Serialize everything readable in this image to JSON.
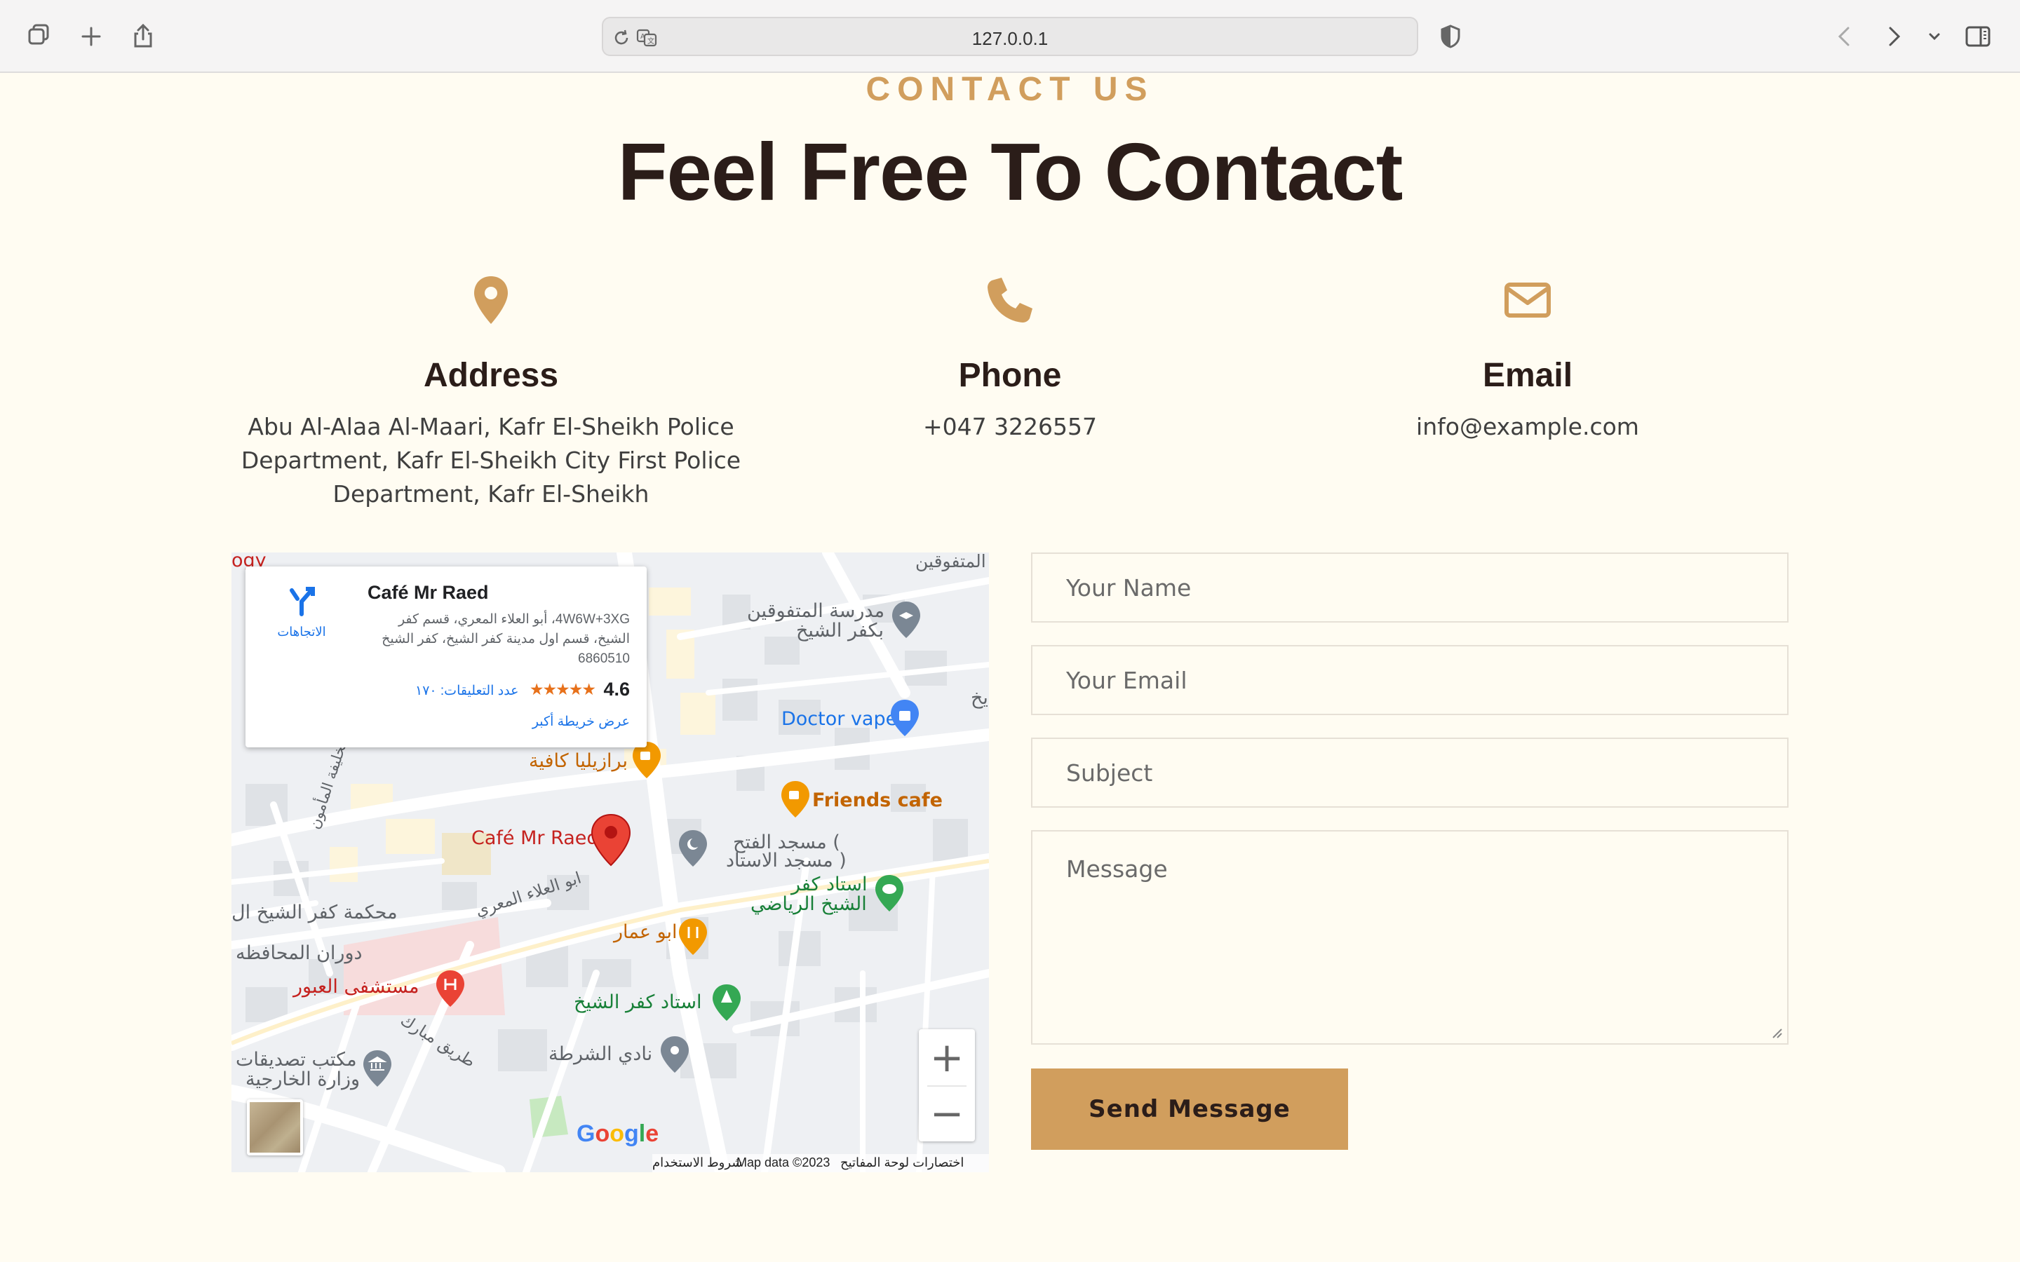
{
  "browser": {
    "url": "127.0.0.1"
  },
  "header": {
    "eyebrow": "CONTACT US",
    "title": "Feel Free To Contact"
  },
  "info": {
    "address": {
      "title": "Address",
      "text": "Abu Al-Alaa Al-Maari, Kafr El-Sheikh Police Department, Kafr El-Sheikh City First Police Department, Kafr El-Sheikh",
      "icon": "map-pin-icon"
    },
    "phone": {
      "title": "Phone",
      "text": "+047 3226557",
      "icon": "phone-icon"
    },
    "email": {
      "title": "Email",
      "text": "info@example.com",
      "icon": "envelope-icon"
    },
    "accent_color": "#d19e5d"
  },
  "map": {
    "card": {
      "name": "Café Mr Raed",
      "address": "4W6W+3XG، أبو العلاء المعري، قسم كفر الشيخ، قسم اول مدينة كفر الشيخ، كفر الشيخ 6860510",
      "rating": "4.6",
      "stars": "★★★★★",
      "reviews": "عدد التعليقات: ١٧٠",
      "larger_map": "عرض خريطة أكبر",
      "directions": "الاتجاهات"
    },
    "labels": {
      "ogy": "ogy",
      "school_top": "المتفوقين",
      "school": "مدرسة المتفوقين",
      "school2": "بكفر الشيخ",
      "doctor_vape": "Doctor vape",
      "kh": "يخ",
      "brazilia": "برازيليا كافية",
      "friends_cafe": "Friends cafe",
      "cafe_raed": "Café Mr Raed",
      "mosque1": "مسجد الفتح (",
      "mosque2": "مسجد الاستاد )",
      "stadium1": "استاد كفر",
      "stadium2": "الشيخ الرياضي",
      "abu_alaa": "ابو العلاء المعري",
      "court": "محكمة كفر الشيخ ال",
      "dawaran": "دوران المحافظه",
      "abu_ammar": "ابو عمار",
      "hospital": "مستشفى العبور",
      "stadium_kafr": "استاد كفر الشيخ",
      "tariq": "طريق مبارك",
      "ministry1": "مكتب تصديقات",
      "ministry2": "وزارة الخارجية",
      "police_club": "نادي الشرطة",
      "caliph": "الخليفة المأمون"
    },
    "zoom_in": "+",
    "zoom_out": "−",
    "google": "Google",
    "footer": {
      "shortcuts": "اختصارات لوحة المفاتيح",
      "mapdata": "Map data ©2023",
      "terms": "شروط الاستخدام"
    }
  },
  "form": {
    "name_placeholder": "Your Name",
    "email_placeholder": "Your Email",
    "subject_placeholder": "Subject",
    "message_placeholder": "Message",
    "submit": "Send Message"
  }
}
